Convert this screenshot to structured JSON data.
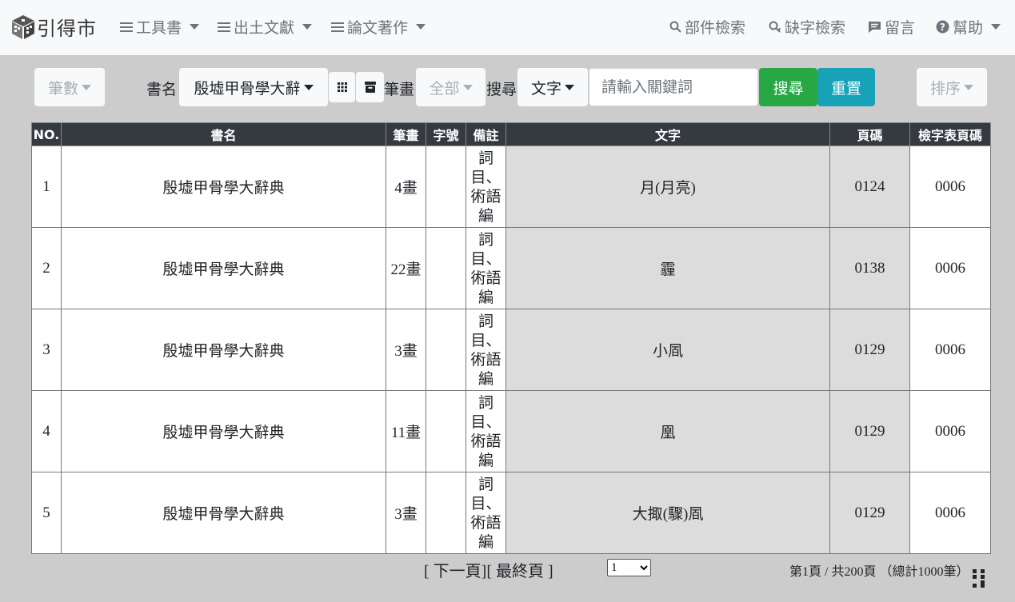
{
  "navbar": {
    "brand": "引得市",
    "menus": [
      {
        "label": "工具書"
      },
      {
        "label": "出土文獻"
      },
      {
        "label": "論文著作"
      }
    ],
    "right": [
      {
        "label": "部件檢索",
        "icon": "search-icon"
      },
      {
        "label": "缺字檢索",
        "icon": "search-key-icon"
      },
      {
        "label": "留言",
        "icon": "comment-icon"
      },
      {
        "label": "幫助",
        "icon": "help-icon"
      }
    ]
  },
  "toolbar": {
    "stroke_filter": "筆數",
    "book_label": "書名",
    "book_selected": "殷墟甲骨學大辭",
    "stroke_label": "筆畫",
    "stroke_selected": "全部",
    "search_label": "搜尋",
    "search_type": "文字",
    "search_placeholder": "請輸入關鍵詞",
    "search_button": "搜尋",
    "reset_button": "重置",
    "sort_button": "排序"
  },
  "table": {
    "headers": {
      "no": "NO.",
      "book": "書名",
      "strokes": "筆畫",
      "char_no": "字號",
      "note": "備註",
      "text": "文字",
      "page": "頁碼",
      "index_page": "檢字表頁碼"
    },
    "rows": [
      {
        "no": "1",
        "book": "殷墟甲骨學大辭典",
        "strokes": "4畫",
        "char_no": "",
        "note": [
          "詞",
          "目、",
          "術語",
          "編"
        ],
        "text": "月(月亮)",
        "page": "0124",
        "index_page": "0006"
      },
      {
        "no": "2",
        "book": "殷墟甲骨學大辭典",
        "strokes": "22畫",
        "char_no": "",
        "note": [
          "詞",
          "目、",
          "術語",
          "編"
        ],
        "text": "霾",
        "page": "0138",
        "index_page": "0006"
      },
      {
        "no": "3",
        "book": "殷墟甲骨學大辭典",
        "strokes": "3畫",
        "char_no": "",
        "note": [
          "詞",
          "目、",
          "術語",
          "編"
        ],
        "text": "小凮",
        "page": "0129",
        "index_page": "0006"
      },
      {
        "no": "4",
        "book": "殷墟甲骨學大辭典",
        "strokes": "11畫",
        "char_no": "",
        "note": [
          "詞",
          "目、",
          "術語",
          "編"
        ],
        "text": "凰",
        "page": "0129",
        "index_page": "0006"
      },
      {
        "no": "5",
        "book": "殷墟甲骨學大辭典",
        "strokes": "3畫",
        "char_no": "",
        "note": [
          "詞",
          "目、",
          "術語",
          "編"
        ],
        "text": "大掫(驟)凮",
        "page": "0129",
        "index_page": "0006"
      }
    ]
  },
  "footer": {
    "next_link": "[ 下一頁]",
    "last_link": "[ 最終頁 ]",
    "page_select_value": "1",
    "page_info": "第1頁 / 共200頁 （總計1000筆）"
  }
}
